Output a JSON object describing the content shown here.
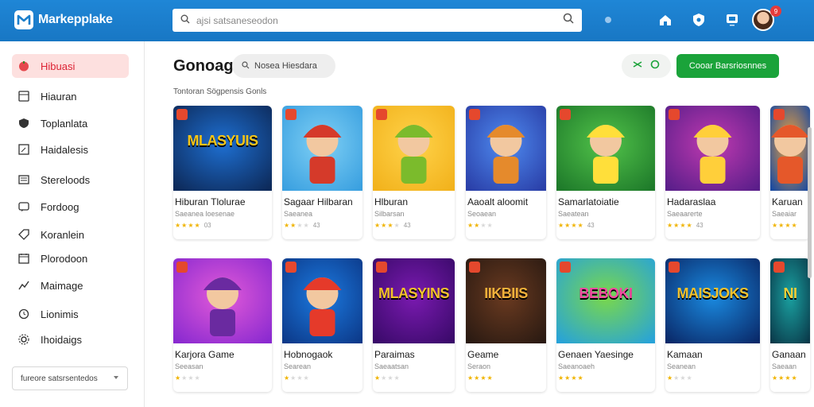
{
  "app": {
    "name": "Markepplake"
  },
  "search": {
    "placeholder": "ajsi satsaneseodon",
    "value": ""
  },
  "topbar": {
    "badge_count": "9"
  },
  "sidebar": {
    "items": [
      {
        "label": "Hibuasi",
        "icon": "tomato-icon",
        "active": true
      },
      {
        "label": "Hiauran",
        "icon": "board-icon"
      },
      {
        "label": "Toplanlata",
        "icon": "shield-icon"
      },
      {
        "label": "Haidalesis",
        "icon": "grid-icon"
      },
      {
        "label": "Stereloods",
        "icon": "list-icon"
      },
      {
        "label": "Fordoog",
        "icon": "message-icon"
      },
      {
        "label": "Koranlein",
        "icon": "tag-icon"
      },
      {
        "label": "Plorodoon",
        "icon": "calendar-icon"
      },
      {
        "label": "Maimage",
        "icon": "chart-icon"
      },
      {
        "label": "Lionimis",
        "icon": "clock-icon"
      },
      {
        "label": "Ihoidaigs",
        "icon": "gear-icon"
      }
    ],
    "select": {
      "value": "fureore satsrsentedos"
    }
  },
  "main": {
    "title": "Gonoag",
    "chip_label": "Nosea Hiesdara",
    "primary_button": "Cooar Barsriosnnes",
    "section_label": "Tontoran Sögpensis Gonls",
    "cards": [
      {
        "title": "Hiburan Tlolurae",
        "subtitle": "Saeanea loesenae",
        "rating": "03",
        "stars": 4,
        "theme": "blue-logo"
      },
      {
        "title": "Sagaar Hilbaran",
        "subtitle": "Saeanea",
        "rating": "43",
        "stars": 2,
        "theme": "red-hair"
      },
      {
        "title": "Hlburan",
        "subtitle": "Silbarsan",
        "rating": "43",
        "stars": 3,
        "theme": "green-bear"
      },
      {
        "title": "Aaoalt aloomit",
        "subtitle": "Seoaean",
        "rating": "",
        "stars": 2,
        "theme": "hero-boy"
      },
      {
        "title": "Samarlatoiatie",
        "subtitle": "Saeatean",
        "rating": "43",
        "stars": 4,
        "theme": "team-green"
      },
      {
        "title": "Hadaraslaa",
        "subtitle": "Saeaarerte",
        "rating": "43",
        "stars": 5,
        "theme": "purple-party"
      },
      {
        "title": "Karuan",
        "subtitle": "Saeaiar",
        "rating": "",
        "stars": 4,
        "theme": "sunset"
      },
      {
        "title": "Karjora Game",
        "subtitle": "Seeasan",
        "rating": "",
        "stars": 1,
        "theme": "purple-girl"
      },
      {
        "title": "Hobnogaok",
        "subtitle": "Searean",
        "rating": "",
        "stars": 1,
        "theme": "kart"
      },
      {
        "title": "Paraimas",
        "subtitle": "Saeaatsan",
        "rating": "",
        "stars": 1,
        "theme": "purple-logo"
      },
      {
        "title": "Geame",
        "subtitle": "Seraon",
        "rating": "",
        "stars": 4,
        "theme": "dark-logo"
      },
      {
        "title": "Genaen Yaesinge",
        "subtitle": "Saeanoaeh",
        "rating": "",
        "stars": 5,
        "theme": "boom"
      },
      {
        "title": "Kamaan",
        "subtitle": "Seanean",
        "rating": "",
        "stars": 1,
        "theme": "blue-logo2"
      },
      {
        "title": "Ganaan",
        "subtitle": "Saeaan",
        "rating": "",
        "stars": 4,
        "theme": "teal-cut"
      }
    ]
  },
  "colors": {
    "topbar": "#1a7ecb",
    "accent_green": "#1aa33a",
    "active_bg": "#fde0df",
    "star": "#f0b400"
  }
}
